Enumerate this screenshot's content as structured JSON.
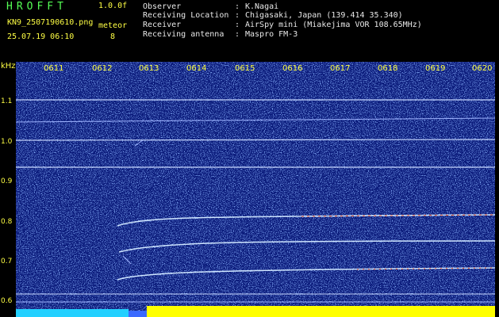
{
  "header": {
    "app_title": "HROFFT",
    "version": "1.0.0f",
    "filename": "KN9_2507190610.png",
    "timestamp": "25.07.19 06:10",
    "meteor_label": "meteor",
    "meteor_count": "8"
  },
  "info": [
    {
      "label": "Observer",
      "value": "K.Nagai"
    },
    {
      "label": "Receiving Location",
      "value": "Chigasaki, Japan (139.414 35.340)"
    },
    {
      "label": "Receiver",
      "value": "AirSpy mini (Miakejima VOR 108.65MHz)"
    },
    {
      "label": "Receiving antenna",
      "value": "Maspro FM-3"
    }
  ],
  "separator": ":",
  "spectrogram": {
    "y_unit": "kHz",
    "y_ticks": [
      "1.1",
      "1.0",
      "0.9",
      "0.8",
      "0.7",
      "0.6"
    ],
    "x_ticks": [
      "0611",
      "0612",
      "0613",
      "0614",
      "0615",
      "0616",
      "0617",
      "0618",
      "0619",
      "0620"
    ],
    "colors": {
      "background": "#0a1a7a",
      "noise": "#4a7aff",
      "carrier": "#c8d8ff",
      "meteor_hot": "#ff6a3a",
      "baseline_left": "#22d0ff",
      "baseline_right": "#ffff00"
    }
  }
}
